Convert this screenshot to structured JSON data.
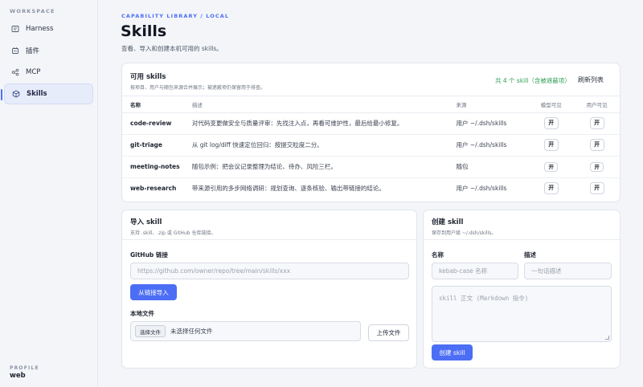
{
  "sidebar": {
    "workspace_label": "WORKSPACE",
    "items": [
      {
        "label": "Harness",
        "icon": "harness-icon"
      },
      {
        "label": "插件",
        "icon": "plugin-icon"
      },
      {
        "label": "MCP",
        "icon": "mcp-icon"
      },
      {
        "label": "Skills",
        "icon": "skills-icon",
        "active": true
      }
    ],
    "profile_label": "PROFILE",
    "profile_name": "web"
  },
  "header": {
    "breadcrumb": "CAPABILITY LIBRARY / LOCAL",
    "title": "Skills",
    "subtitle": "查看、导入和创建本机可用的 skills。"
  },
  "skills_panel": {
    "title": "可用 skills",
    "description": "按项目、用户与随包来源合并展示；被遮蔽项仍保留用于排查。",
    "summary": "共 4 个 skill（含被遮蔽项）",
    "refresh_label": "刷新列表",
    "columns": [
      "名称",
      "描述",
      "来源",
      "模型可见",
      "用户可见"
    ],
    "rows": [
      {
        "name": "code-review",
        "description": "对代码变更做安全与质量评审：先找注入点，再看可维护性，最后给最小修复。",
        "source": "用户 ~/.dsh/skills",
        "model_visible": "开",
        "user_visible": "开"
      },
      {
        "name": "git-triage",
        "description": "从 git log/diff 快速定位回归：按提交粒度二分。",
        "source": "用户 ~/.dsh/skills",
        "model_visible": "开",
        "user_visible": "开"
      },
      {
        "name": "meeting-notes",
        "description": "随包示例：把会议记录整理为结论、待办、风险三栏。",
        "source": "随包",
        "model_visible": "开",
        "user_visible": "开"
      },
      {
        "name": "web-research",
        "description": "带来源引用的多步网络调研：规划查询、逐条核验、输出带链接的结论。",
        "source": "用户 ~/.dsh/skills",
        "model_visible": "开",
        "user_visible": "开"
      }
    ]
  },
  "import_panel": {
    "title": "导入 skill",
    "description": "支持 .skill、.zip 或 GitHub 仓库链接。",
    "github_label": "GitHub 链接",
    "github_placeholder": "https://github.com/owner/repo/tree/main/skills/xxx",
    "import_button": "从链接导入",
    "local_label": "本地文件",
    "choose_button": "选择文件",
    "no_file_text": "未选择任何文件",
    "upload_button": "上传文件"
  },
  "create_panel": {
    "title": "创建 skill",
    "description": "保存到用户级 ~/.dsh/skills。",
    "name_label": "名称",
    "name_placeholder": "kebab-case 名称",
    "desc_label": "描述",
    "desc_placeholder": "一句话描述",
    "body_placeholder": "skill 正文 (Markdown 指令)",
    "create_button": "创建 skill"
  },
  "colors": {
    "accent": "#4c6ef5",
    "success": "#2f9e55",
    "background": "#f3f5f9"
  }
}
